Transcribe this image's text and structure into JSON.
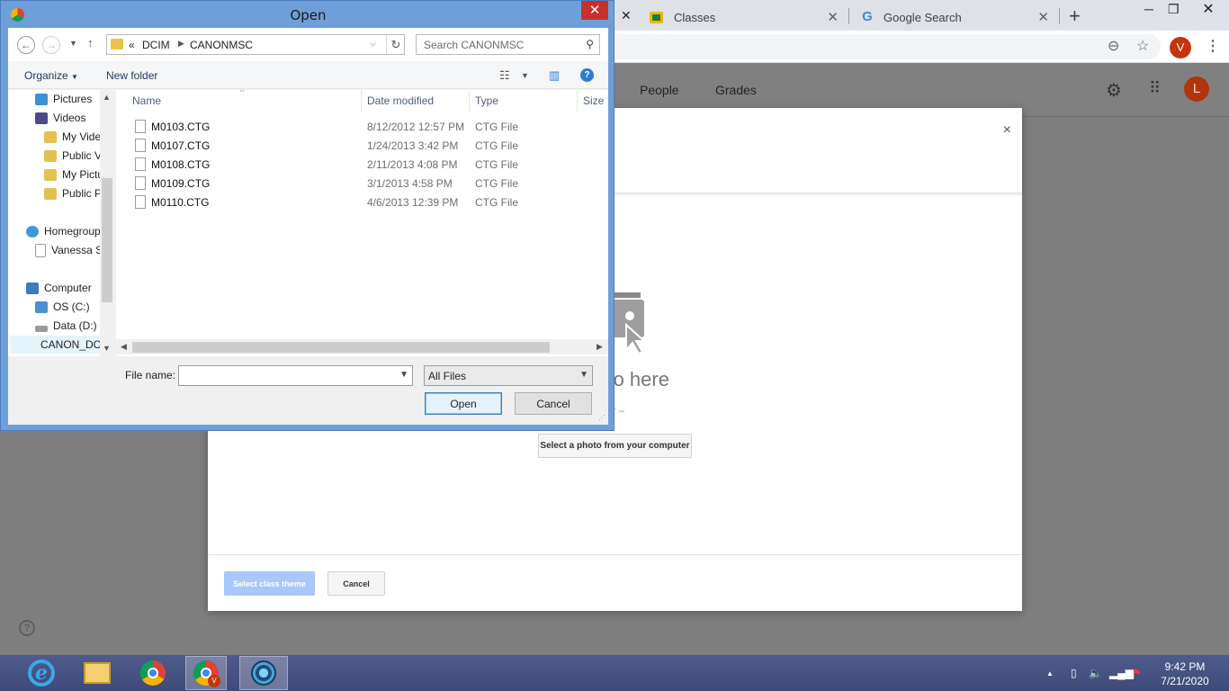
{
  "browser": {
    "tabs": [
      {
        "title": "Classes",
        "close": "✕"
      },
      {
        "title": "Google Search",
        "close": "✕"
      }
    ],
    "active_tab_close": "✕",
    "new_tab": "+",
    "profile_initial": "V"
  },
  "classroom": {
    "nav": {
      "people": "People",
      "grades": "Grades"
    },
    "profile_initial": "L",
    "help": "?"
  },
  "modal": {
    "close": "×",
    "drop_text": "hoto here",
    "or_text": "or –",
    "select_button": "Select a photo from your computer",
    "theme_button": "Select class theme",
    "cancel_button": "Cancel"
  },
  "dialog": {
    "title": "Open",
    "close": "✕",
    "breadcrumb": {
      "overflow": "«",
      "items": [
        "DCIM",
        "CANONMSC"
      ]
    },
    "search_placeholder": "Search CANONMSC",
    "organize": "Organize",
    "new_folder": "New folder",
    "help": "?",
    "nav_items": [
      {
        "label": "Pictures",
        "color": "#3d8fd6"
      },
      {
        "label": "Videos",
        "color": "#4a4a8a"
      },
      {
        "label": "My Videos",
        "color": "#e3c14f"
      },
      {
        "label": "Public Videos",
        "color": "#e3c14f"
      },
      {
        "label": "My Pictures",
        "color": "#e3c14f"
      },
      {
        "label": "Public Pictures",
        "color": "#e3c14f"
      },
      {
        "label": "Homegroup",
        "color": "#3c9ad8"
      },
      {
        "label": "Vanessa S",
        "color": "#ffffff"
      },
      {
        "label": "Computer",
        "color": "#3d7bbf"
      },
      {
        "label": "OS (C:)",
        "color": "#4a90d0"
      },
      {
        "label": "Data (D:)",
        "color": "#9a9a9a"
      },
      {
        "label": "CANON_DC",
        "color": "#2c3f9a"
      }
    ],
    "columns": {
      "name": "Name",
      "date": "Date modified",
      "type": "Type",
      "size": "Size"
    },
    "files": [
      {
        "name": "M0103.CTG",
        "date": "8/12/2012 12:57 PM",
        "type": "CTG File"
      },
      {
        "name": "M0107.CTG",
        "date": "1/24/2013 3:42 PM",
        "type": "CTG File"
      },
      {
        "name": "M0108.CTG",
        "date": "2/11/2013 4:08 PM",
        "type": "CTG File"
      },
      {
        "name": "M0109.CTG",
        "date": "3/1/2013 4:58 PM",
        "type": "CTG File"
      },
      {
        "name": "M0110.CTG",
        "date": "4/6/2013 12:39 PM",
        "type": "CTG File"
      }
    ],
    "file_name_label": "File name:",
    "file_name_value": "",
    "filter": "All Files",
    "open_button": "Open",
    "cancel_button": "Cancel"
  },
  "taskbar": {
    "clock_time": "9:42 PM",
    "clock_date": "7/21/2020",
    "chrome_badge": "V"
  }
}
